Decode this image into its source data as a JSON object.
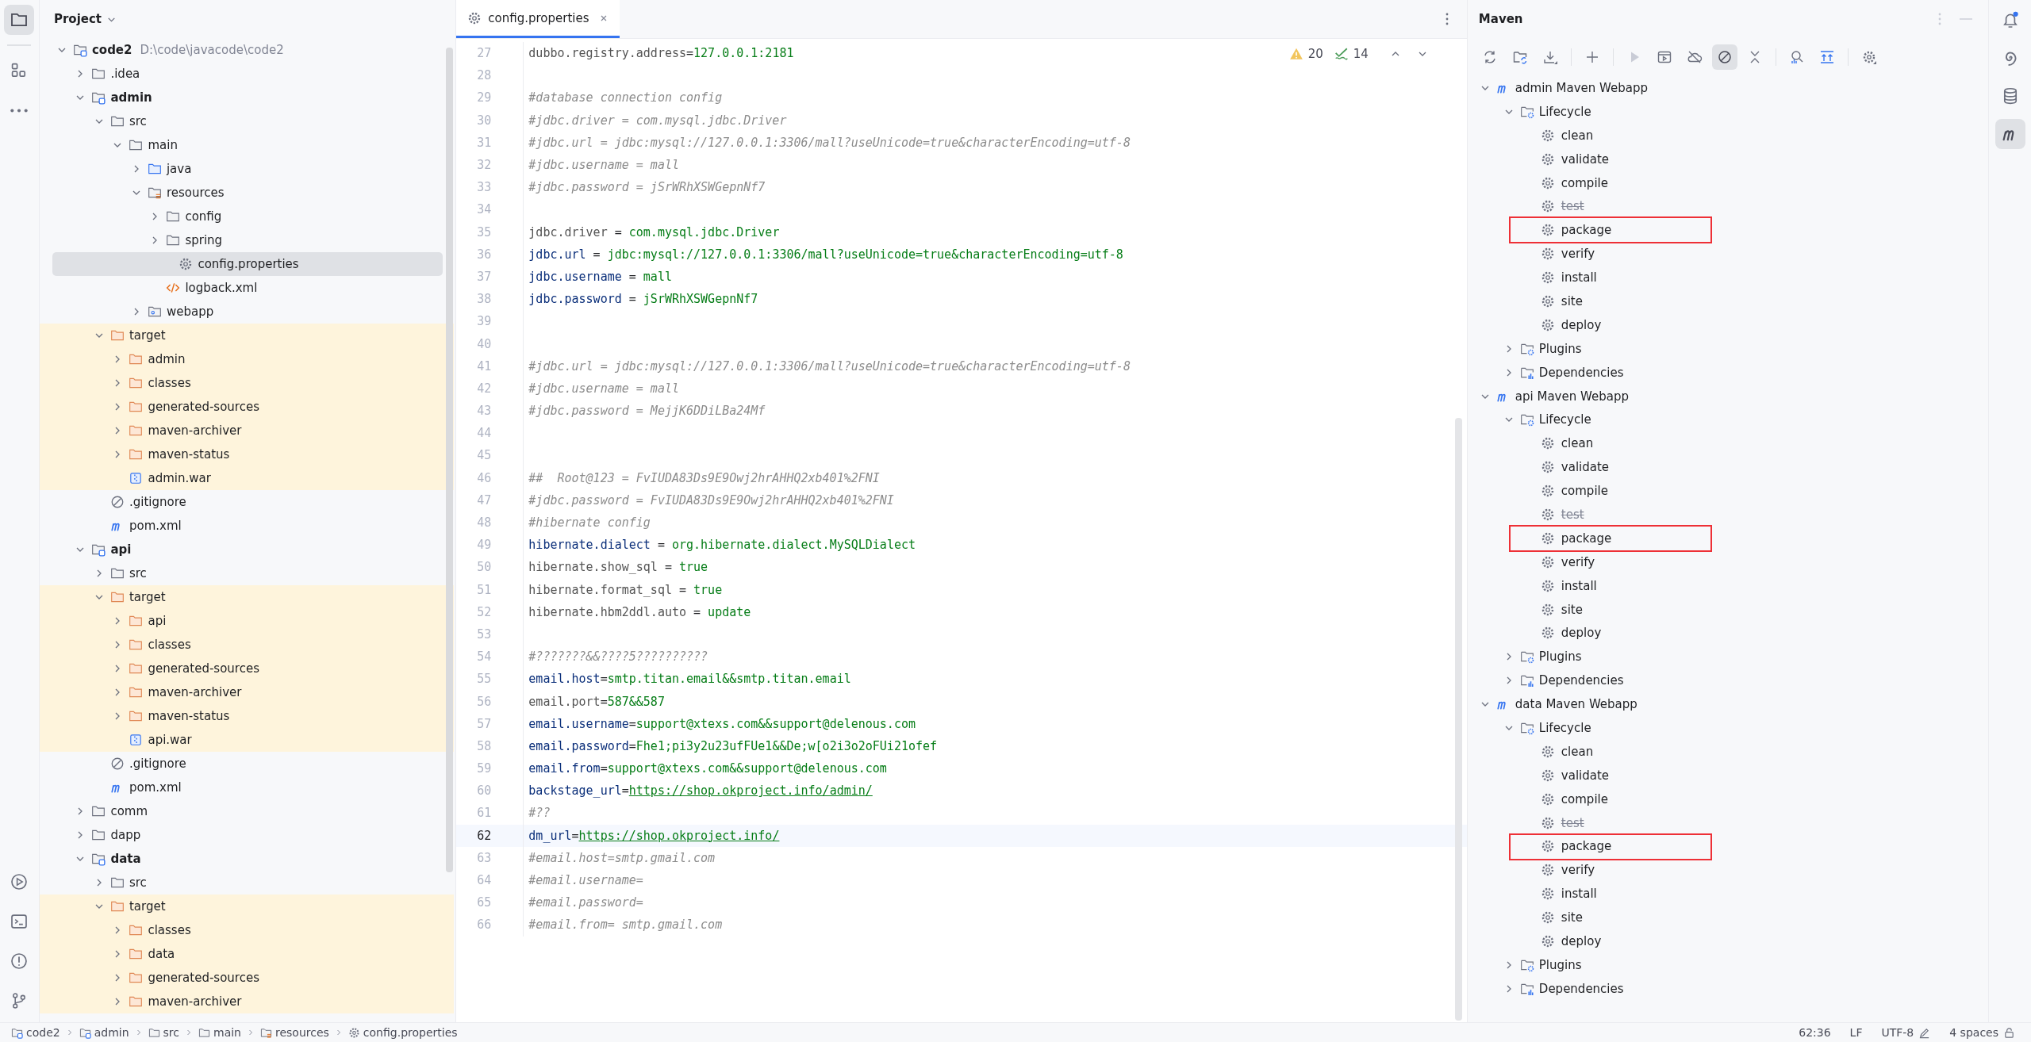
{
  "project": {
    "title": "Project",
    "tree": [
      {
        "label": "code2",
        "hint": "D:\\code\\javacode\\code2",
        "kind": "module",
        "expanded": true,
        "selected": false,
        "children": [
          {
            "label": ".idea",
            "kind": "folder",
            "expanded": false,
            "selected": false
          },
          {
            "label": "admin",
            "kind": "module",
            "expanded": true,
            "selected": false,
            "children": [
              {
                "label": "src",
                "kind": "folder",
                "expanded": true,
                "selected": false,
                "children": [
                  {
                    "label": "main",
                    "kind": "folder",
                    "expanded": true,
                    "selected": false,
                    "children": [
                      {
                        "label": "java",
                        "kind": "source-folder",
                        "expanded": false,
                        "selected": false
                      },
                      {
                        "label": "resources",
                        "kind": "resource-folder",
                        "expanded": true,
                        "selected": false,
                        "children": [
                          {
                            "label": "config",
                            "kind": "folder",
                            "expanded": false,
                            "selected": false
                          },
                          {
                            "label": "spring",
                            "kind": "folder",
                            "expanded": false,
                            "selected": false
                          },
                          {
                            "label": "config.properties",
                            "kind": "properties",
                            "selected": true
                          },
                          {
                            "label": "logback.xml",
                            "kind": "xml",
                            "selected": false
                          }
                        ]
                      },
                      {
                        "label": "webapp",
                        "kind": "web-folder",
                        "expanded": false,
                        "selected": false
                      }
                    ]
                  }
                ]
              },
              {
                "label": "target",
                "kind": "excluded-folder",
                "expanded": true,
                "selected": false,
                "children": [
                  {
                    "label": "admin",
                    "kind": "excluded-folder",
                    "expanded": false,
                    "selected": false
                  },
                  {
                    "label": "classes",
                    "kind": "excluded-folder",
                    "expanded": false,
                    "selected": false
                  },
                  {
                    "label": "generated-sources",
                    "kind": "excluded-folder",
                    "expanded": false,
                    "selected": false
                  },
                  {
                    "label": "maven-archiver",
                    "kind": "excluded-folder",
                    "expanded": false,
                    "selected": false
                  },
                  {
                    "label": "maven-status",
                    "kind": "excluded-folder",
                    "expanded": false,
                    "selected": false
                  },
                  {
                    "label": "admin.war",
                    "kind": "war",
                    "selected": false
                  }
                ]
              },
              {
                "label": ".gitignore",
                "kind": "ignore",
                "selected": false
              },
              {
                "label": "pom.xml",
                "kind": "pom",
                "selected": false
              }
            ]
          },
          {
            "label": "api",
            "kind": "module",
            "expanded": true,
            "selected": false,
            "children": [
              {
                "label": "src",
                "kind": "folder",
                "expanded": false,
                "selected": false
              },
              {
                "label": "target",
                "kind": "excluded-folder",
                "expanded": true,
                "selected": false,
                "children": [
                  {
                    "label": "api",
                    "kind": "excluded-folder",
                    "expanded": false,
                    "selected": false
                  },
                  {
                    "label": "classes",
                    "kind": "excluded-folder",
                    "expanded": false,
                    "selected": false
                  },
                  {
                    "label": "generated-sources",
                    "kind": "excluded-folder",
                    "expanded": false,
                    "selected": false
                  },
                  {
                    "label": "maven-archiver",
                    "kind": "excluded-folder",
                    "expanded": false,
                    "selected": false
                  },
                  {
                    "label": "maven-status",
                    "kind": "excluded-folder",
                    "expanded": false,
                    "selected": false
                  },
                  {
                    "label": "api.war",
                    "kind": "war",
                    "selected": false
                  }
                ]
              },
              {
                "label": ".gitignore",
                "kind": "ignore",
                "selected": false
              },
              {
                "label": "pom.xml",
                "kind": "pom",
                "selected": false
              }
            ]
          },
          {
            "label": "comm",
            "kind": "folder",
            "expanded": false,
            "selected": false
          },
          {
            "label": "dapp",
            "kind": "folder",
            "expanded": false,
            "selected": false
          },
          {
            "label": "data",
            "kind": "module",
            "expanded": true,
            "selected": false,
            "children": [
              {
                "label": "src",
                "kind": "folder",
                "expanded": false,
                "selected": false
              },
              {
                "label": "target",
                "kind": "excluded-folder",
                "expanded": true,
                "selected": false,
                "children": [
                  {
                    "label": "classes",
                    "kind": "excluded-folder",
                    "expanded": false,
                    "selected": false
                  },
                  {
                    "label": "data",
                    "kind": "excluded-folder",
                    "expanded": false,
                    "selected": false
                  },
                  {
                    "label": "generated-sources",
                    "kind": "excluded-folder",
                    "expanded": false,
                    "selected": false
                  },
                  {
                    "label": "maven-archiver",
                    "kind": "excluded-folder",
                    "expanded": false,
                    "selected": false
                  }
                ]
              }
            ]
          }
        ]
      }
    ]
  },
  "editor": {
    "tab": {
      "label": "config.properties",
      "selected": true
    },
    "warnings": "20",
    "checks": "14",
    "lines": [
      {
        "n": "27",
        "current": false,
        "segs": [
          {
            "kind": "unused-key",
            "t": "dubbo.registry.address"
          },
          {
            "kind": "sign",
            "t": "="
          },
          {
            "kind": "value",
            "t": "127.0.0.1:2181"
          }
        ]
      },
      {
        "n": "28",
        "current": false
      },
      {
        "n": "29",
        "current": false,
        "segs": [
          {
            "kind": "comment",
            "t": "#database connection config"
          }
        ]
      },
      {
        "n": "30",
        "current": false,
        "segs": [
          {
            "kind": "comment",
            "t": "#jdbc.driver = com.mysql.jdbc.Driver"
          }
        ]
      },
      {
        "n": "31",
        "current": false,
        "segs": [
          {
            "kind": "comment",
            "t": "#jdbc.url = jdbc:mysql://127.0.0.1:3306/mall?useUnicode=true&characterEncoding=utf-8"
          }
        ]
      },
      {
        "n": "32",
        "current": false,
        "segs": [
          {
            "kind": "comment",
            "t": "#jdbc.username = mall"
          }
        ]
      },
      {
        "n": "33",
        "current": false,
        "segs": [
          {
            "kind": "comment",
            "t": "#jdbc.password = jSrWRhXSWGepnNf7"
          }
        ]
      },
      {
        "n": "34",
        "current": false
      },
      {
        "n": "35",
        "current": false,
        "segs": [
          {
            "kind": "unused-key",
            "t": "jdbc.driver"
          },
          {
            "kind": "sign",
            "t": " = "
          },
          {
            "kind": "value",
            "t": "com.mysql.jdbc.Driver"
          }
        ]
      },
      {
        "n": "36",
        "current": false,
        "segs": [
          {
            "kind": "key",
            "t": "jdbc.url"
          },
          {
            "kind": "sign",
            "t": " = "
          },
          {
            "kind": "value",
            "t": "jdbc:mysql://127.0.0.1:3306/mall?useUnicode=true&characterEncoding=utf-8"
          }
        ]
      },
      {
        "n": "37",
        "current": false,
        "segs": [
          {
            "kind": "key",
            "t": "jdbc.username"
          },
          {
            "kind": "sign",
            "t": " = "
          },
          {
            "kind": "value",
            "t": "mall"
          }
        ]
      },
      {
        "n": "38",
        "current": false,
        "segs": [
          {
            "kind": "key",
            "t": "jdbc.password"
          },
          {
            "kind": "sign",
            "t": " = "
          },
          {
            "kind": "value",
            "t": "jSrWRhXSWGepnNf7"
          }
        ]
      },
      {
        "n": "39",
        "current": false
      },
      {
        "n": "40",
        "current": false
      },
      {
        "n": "41",
        "current": false,
        "segs": [
          {
            "kind": "comment",
            "t": "#jdbc.url = jdbc:mysql://127.0.0.1:3306/mall?useUnicode=true&characterEncoding=utf-8"
          }
        ]
      },
      {
        "n": "42",
        "current": false,
        "segs": [
          {
            "kind": "comment",
            "t": "#jdbc.username = mall"
          }
        ]
      },
      {
        "n": "43",
        "current": false,
        "segs": [
          {
            "kind": "comment",
            "t": "#jdbc.password = MejjK6DDiLBa24Mf"
          }
        ]
      },
      {
        "n": "44",
        "current": false
      },
      {
        "n": "45",
        "current": false
      },
      {
        "n": "46",
        "current": false,
        "segs": [
          {
            "kind": "comment",
            "t": "##  Root@123 = FvIUDA83Ds9E9Owj2hrAHHQ2xb401%2FNI"
          }
        ]
      },
      {
        "n": "47",
        "current": false,
        "segs": [
          {
            "kind": "comment",
            "t": "#jdbc.password = FvIUDA83Ds9E9Owj2hrAHHQ2xb401%2FNI"
          }
        ]
      },
      {
        "n": "48",
        "current": false,
        "segs": [
          {
            "kind": "comment",
            "t": "#hibernate config"
          }
        ]
      },
      {
        "n": "49",
        "current": false,
        "segs": [
          {
            "kind": "key",
            "t": "hibernate.dialect"
          },
          {
            "kind": "sign",
            "t": " = "
          },
          {
            "kind": "value",
            "t": "org.hibernate.dialect.MySQLDialect"
          }
        ]
      },
      {
        "n": "50",
        "current": false,
        "segs": [
          {
            "kind": "unused-key",
            "t": "hibernate.show_sql"
          },
          {
            "kind": "sign",
            "t": " = "
          },
          {
            "kind": "value",
            "t": "true"
          }
        ]
      },
      {
        "n": "51",
        "current": false,
        "segs": [
          {
            "kind": "unused-key",
            "t": "hibernate.format_sql"
          },
          {
            "kind": "sign",
            "t": " = "
          },
          {
            "kind": "value",
            "t": "true"
          }
        ]
      },
      {
        "n": "52",
        "current": false,
        "segs": [
          {
            "kind": "unused-key",
            "t": "hibernate.hbm2ddl.auto"
          },
          {
            "kind": "sign",
            "t": " = "
          },
          {
            "kind": "value",
            "t": "update"
          }
        ]
      },
      {
        "n": "53",
        "current": false
      },
      {
        "n": "54",
        "current": false,
        "segs": [
          {
            "kind": "comment",
            "t": "#???????&&????5??????????"
          }
        ]
      },
      {
        "n": "55",
        "current": false,
        "segs": [
          {
            "kind": "key",
            "t": "email.host"
          },
          {
            "kind": "sign",
            "t": "="
          },
          {
            "kind": "value",
            "t": "smtp.titan.email&&smtp.titan.email"
          }
        ]
      },
      {
        "n": "56",
        "current": false,
        "segs": [
          {
            "kind": "unused-key",
            "t": "email.port"
          },
          {
            "kind": "sign",
            "t": "="
          },
          {
            "kind": "value",
            "t": "587&&587"
          }
        ]
      },
      {
        "n": "57",
        "current": false,
        "segs": [
          {
            "kind": "key",
            "t": "email.username"
          },
          {
            "kind": "sign",
            "t": "="
          },
          {
            "kind": "value",
            "t": "support@xtexs.com&&support@delenous.com"
          }
        ]
      },
      {
        "n": "58",
        "current": false,
        "segs": [
          {
            "kind": "key",
            "t": "email.password"
          },
          {
            "kind": "sign",
            "t": "="
          },
          {
            "kind": "value",
            "t": "Fhe1;pi3y2u23ufFUe1&&De;w[o2i3o2oFUi21ofef"
          }
        ]
      },
      {
        "n": "59",
        "current": false,
        "segs": [
          {
            "kind": "key",
            "t": "email.from"
          },
          {
            "kind": "sign",
            "t": "="
          },
          {
            "kind": "value",
            "t": "support@xtexs.com&&support@delenous.com"
          }
        ]
      },
      {
        "n": "60",
        "current": false,
        "segs": [
          {
            "kind": "key",
            "t": "backstage_url"
          },
          {
            "kind": "sign",
            "t": "="
          },
          {
            "kind": "link",
            "t": "https://shop.okproject.info/admin/"
          }
        ]
      },
      {
        "n": "61",
        "current": false,
        "segs": [
          {
            "kind": "comment",
            "t": "#??"
          }
        ]
      },
      {
        "n": "62",
        "current": true,
        "segs": [
          {
            "kind": "key",
            "t": "dm_url"
          },
          {
            "kind": "sign",
            "t": "="
          },
          {
            "kind": "link",
            "t": "https://shop.okproject.info/"
          }
        ]
      },
      {
        "n": "63",
        "current": false,
        "segs": [
          {
            "kind": "comment",
            "t": "#email.host=smtp.gmail.com"
          }
        ]
      },
      {
        "n": "64",
        "current": false,
        "segs": [
          {
            "kind": "comment",
            "t": "#email.username="
          }
        ]
      },
      {
        "n": "65",
        "current": false,
        "segs": [
          {
            "kind": "comment",
            "t": "#email.password="
          }
        ]
      },
      {
        "n": "66",
        "current": false,
        "segs": [
          {
            "kind": "comment",
            "t": "#email.from= smtp.gmail.com"
          }
        ]
      }
    ]
  },
  "maven": {
    "title": "Maven",
    "skip_tests": true,
    "projects": [
      {
        "name": "admin Maven Webapp",
        "expanded": true,
        "groups": [
          {
            "name": "Lifecycle",
            "kind": "lifecycle",
            "expanded": true,
            "goals": [
              {
                "name": "clean",
                "disabled": false,
                "marked": false
              },
              {
                "name": "validate",
                "disabled": false,
                "marked": false
              },
              {
                "name": "compile",
                "disabled": false,
                "marked": false
              },
              {
                "name": "test",
                "disabled": true,
                "marked": false
              },
              {
                "name": "package",
                "disabled": false,
                "marked": true
              },
              {
                "name": "verify",
                "disabled": false,
                "marked": false
              },
              {
                "name": "install",
                "disabled": false,
                "marked": false
              },
              {
                "name": "site",
                "disabled": false,
                "marked": false
              },
              {
                "name": "deploy",
                "disabled": false,
                "marked": false
              }
            ]
          },
          {
            "name": "Plugins",
            "kind": "plugins",
            "expanded": false
          },
          {
            "name": "Dependencies",
            "kind": "dependencies",
            "expanded": false
          }
        ]
      },
      {
        "name": "api Maven Webapp",
        "expanded": true,
        "groups": [
          {
            "name": "Lifecycle",
            "kind": "lifecycle",
            "expanded": true,
            "goals": [
              {
                "name": "clean",
                "disabled": false,
                "marked": false
              },
              {
                "name": "validate",
                "disabled": false,
                "marked": false
              },
              {
                "name": "compile",
                "disabled": false,
                "marked": false
              },
              {
                "name": "test",
                "disabled": true,
                "marked": false
              },
              {
                "name": "package",
                "disabled": false,
                "marked": true
              },
              {
                "name": "verify",
                "disabled": false,
                "marked": false
              },
              {
                "name": "install",
                "disabled": false,
                "marked": false
              },
              {
                "name": "site",
                "disabled": false,
                "marked": false
              },
              {
                "name": "deploy",
                "disabled": false,
                "marked": false
              }
            ]
          },
          {
            "name": "Plugins",
            "kind": "plugins",
            "expanded": false
          },
          {
            "name": "Dependencies",
            "kind": "dependencies",
            "expanded": false
          }
        ]
      },
      {
        "name": "data Maven Webapp",
        "expanded": true,
        "groups": [
          {
            "name": "Lifecycle",
            "kind": "lifecycle",
            "expanded": true,
            "goals": [
              {
                "name": "clean",
                "disabled": false,
                "marked": false
              },
              {
                "name": "validate",
                "disabled": false,
                "marked": false
              },
              {
                "name": "compile",
                "disabled": false,
                "marked": false
              },
              {
                "name": "test",
                "disabled": true,
                "marked": false
              },
              {
                "name": "package",
                "disabled": false,
                "marked": true
              },
              {
                "name": "verify",
                "disabled": false,
                "marked": false
              },
              {
                "name": "install",
                "disabled": false,
                "marked": false
              },
              {
                "name": "site",
                "disabled": false,
                "marked": false
              },
              {
                "name": "deploy",
                "disabled": false,
                "marked": false
              }
            ]
          },
          {
            "name": "Plugins",
            "kind": "plugins",
            "expanded": false
          },
          {
            "name": "Dependencies",
            "kind": "dependencies",
            "expanded": false
          }
        ]
      }
    ]
  },
  "status_bar": {
    "breadcrumbs": [
      {
        "label": "code2",
        "kind": "module"
      },
      {
        "label": "admin",
        "kind": "module"
      },
      {
        "label": "src",
        "kind": "folder"
      },
      {
        "label": "main",
        "kind": "folder"
      },
      {
        "label": "resources",
        "kind": "resource-folder"
      },
      {
        "label": "config.properties",
        "kind": "properties"
      }
    ],
    "position": "62:36",
    "line_ending": "LF",
    "encoding": "UTF-8",
    "indent": "4 spaces"
  }
}
